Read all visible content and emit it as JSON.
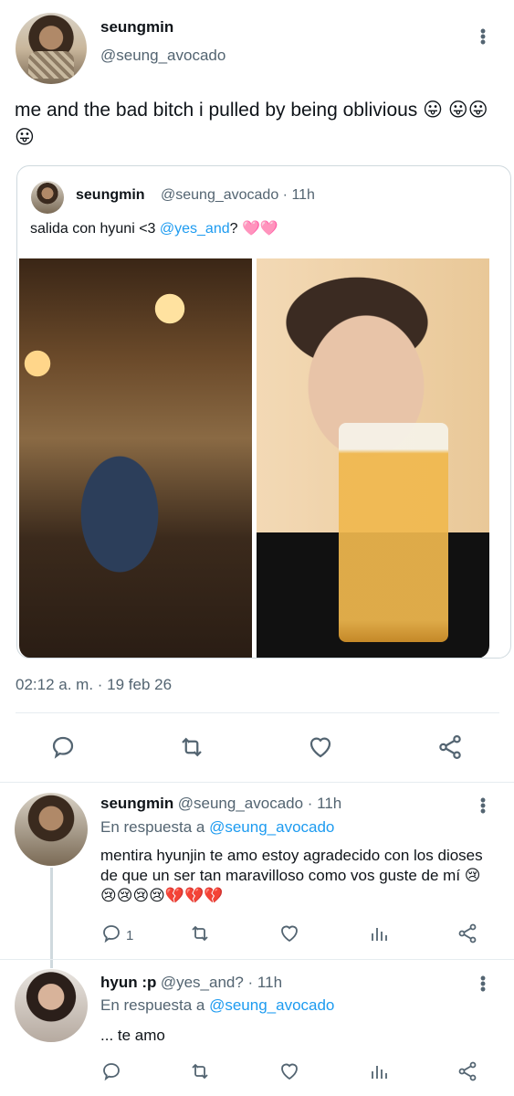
{
  "main_tweet": {
    "author_name": "seungmin",
    "author_handle": "@seung_avocado",
    "text": "me and the bad bitch i pulled by being oblivious 😛 😛😛😛",
    "timestamp": "02:12 a. m. · 19 feb 26"
  },
  "quoted_tweet": {
    "author_name": "seungmin",
    "author_handle": "@seung_avocado · 11h",
    "text_prefix": "salida con hyuni <3 ",
    "mention": "@yes_and",
    "text_suffix": "? 🩷🩷"
  },
  "replies": [
    {
      "author_name": "seungmin",
      "author_handle": "@seung_avocado · 11h",
      "in_reply_prefix": "En respuesta a ",
      "in_reply_mention": "@seung_avocado",
      "text": "mentira hyunjin te amo estoy agradecido con los dioses de que un ser tan maravilloso como vos guste de mí 😢😢😢😢😢💔💔💔",
      "reply_count": "1"
    },
    {
      "author_name": "hyun :p",
      "author_handle": "@yes_and? · 11h",
      "in_reply_prefix": "En respuesta a ",
      "in_reply_mention": "@seung_avocado",
      "text": "... te amo"
    }
  ],
  "icons": {
    "reply": "reply-icon",
    "retweet": "retweet-icon",
    "like": "heart-icon",
    "share": "share-icon",
    "analytics": "analytics-icon",
    "more": "more-icon"
  },
  "colors": {
    "link": "#1d9bf0",
    "secondary_text": "#536471",
    "divider": "#e6ecf0"
  }
}
